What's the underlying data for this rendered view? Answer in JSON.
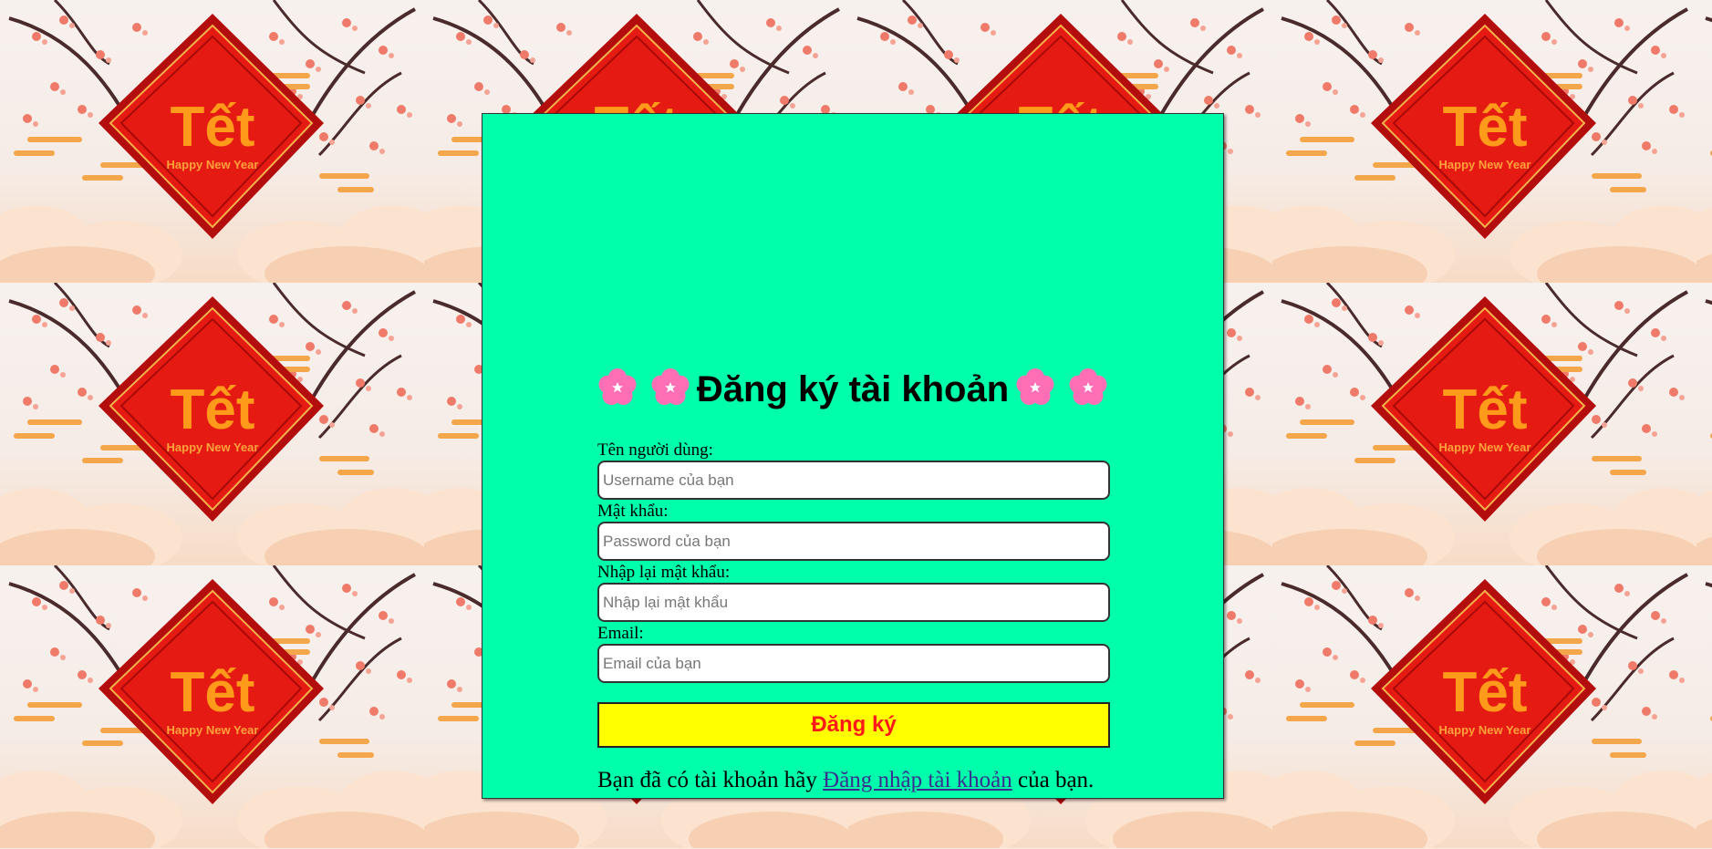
{
  "background": {
    "tile_main_text": "Tết",
    "tile_sub_text": "Happy New Year"
  },
  "form": {
    "title": "Đăng ký tài khoản",
    "fields": {
      "username": {
        "label": "Tên người dùng:",
        "placeholder": "Username của bạn"
      },
      "password": {
        "label": "Mật khẩu:",
        "placeholder": "Password của bạn"
      },
      "confirm": {
        "label": "Nhập lại mật khẩu:",
        "placeholder": "Nhập lại mật khẩu"
      },
      "email": {
        "label": "Email:",
        "placeholder": "Email của bạn"
      }
    },
    "submit_label": "Đăng ký",
    "footer_prefix": "Bạn đã có tài khoản hãy ",
    "footer_link": "Đăng nhập tài khoản",
    "footer_suffix": " của bạn."
  },
  "colors": {
    "panel_bg": "#00ffaa",
    "button_bg": "#ffff00",
    "button_text": "#ff1a1a",
    "flower": "#ff6fb5"
  }
}
